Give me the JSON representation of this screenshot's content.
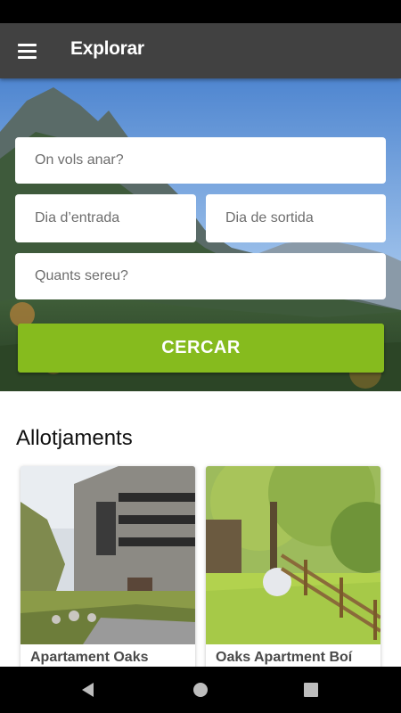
{
  "app_bar": {
    "title": "Explorar",
    "menu_icon": "menu-icon"
  },
  "search": {
    "destination_placeholder": "On vols anar?",
    "checkin_placeholder": "Dia d’entrada",
    "checkout_placeholder": "Dia de sortida",
    "guests_placeholder": "Quants sereu?",
    "button_label": "CERCAR"
  },
  "accommodations": {
    "section_title": "Allotjaments",
    "items": [
      {
        "name": "Apartament Oaks"
      },
      {
        "name": "Oaks Apartment Boí"
      }
    ]
  },
  "nav": {
    "back_icon": "back-triangle-icon",
    "home_icon": "home-circle-icon",
    "recent_icon": "recent-square-icon"
  },
  "colors": {
    "app_bar": "#414141",
    "accent": "#86bb1e",
    "nav_bar": "#000000"
  }
}
